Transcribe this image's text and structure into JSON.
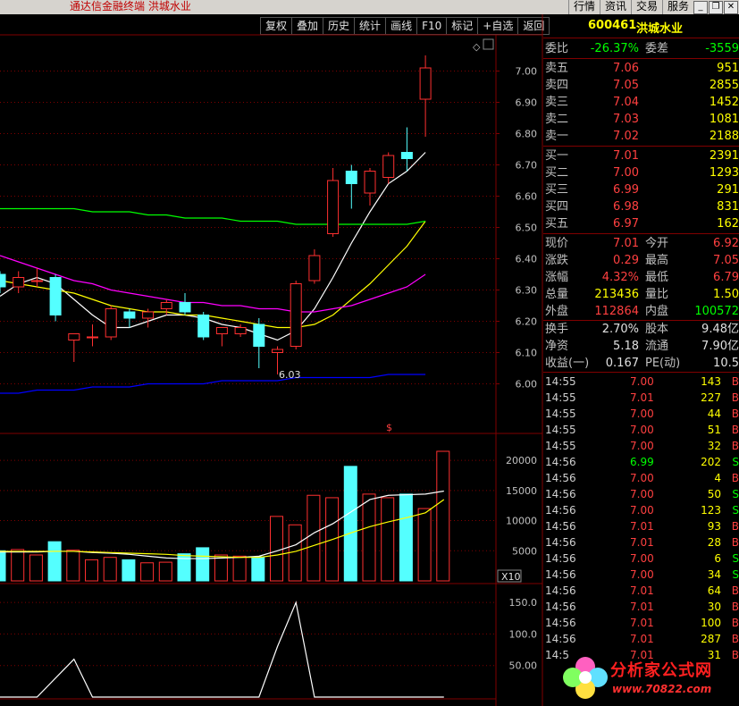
{
  "window": {
    "title": "通达信金融终端  洪城水业",
    "menu": [
      "行情",
      "资讯",
      "交易",
      "服务"
    ],
    "buttons": [
      "_",
      "❐",
      "✕"
    ]
  },
  "toolbar": [
    "复权",
    "叠加",
    "历史",
    "统计",
    "画线",
    "F10",
    "标记",
    "+自选",
    "返回"
  ],
  "chart_data": [
    {
      "type": "candlestick",
      "panel": "price",
      "y_ticks": [
        "7.00",
        "6.90",
        "6.80",
        "6.70",
        "6.60",
        "6.50",
        "6.40",
        "6.30",
        "6.20",
        "6.10",
        "6.00"
      ],
      "ylim": [
        5.97,
        7.05
      ],
      "candles": [
        {
          "o": 6.35,
          "c": 6.31,
          "h": 6.36,
          "l": 6.29
        },
        {
          "o": 6.31,
          "c": 6.34,
          "h": 6.36,
          "l": 6.29
        },
        {
          "o": 6.33,
          "c": 6.33,
          "h": 6.37,
          "l": 6.31
        },
        {
          "o": 6.34,
          "c": 6.22,
          "h": 6.35,
          "l": 6.2
        },
        {
          "o": 6.14,
          "c": 6.16,
          "h": 6.16,
          "l": 6.07
        },
        {
          "o": 6.15,
          "c": 6.15,
          "h": 6.19,
          "l": 6.12
        },
        {
          "o": 6.15,
          "c": 6.24,
          "h": 6.25,
          "l": 6.14
        },
        {
          "o": 6.23,
          "c": 6.21,
          "h": 6.24,
          "l": 6.18
        },
        {
          "o": 6.21,
          "c": 6.23,
          "h": 6.24,
          "l": 6.18
        },
        {
          "o": 6.24,
          "c": 6.26,
          "h": 6.27,
          "l": 6.22
        },
        {
          "o": 6.26,
          "c": 6.23,
          "h": 6.29,
          "l": 6.22
        },
        {
          "o": 6.22,
          "c": 6.15,
          "h": 6.23,
          "l": 6.14
        },
        {
          "o": 6.16,
          "c": 6.18,
          "h": 6.18,
          "l": 6.12
        },
        {
          "o": 6.16,
          "c": 6.18,
          "h": 6.19,
          "l": 6.15
        },
        {
          "o": 6.19,
          "c": 6.12,
          "h": 6.21,
          "l": 6.05
        },
        {
          "o": 6.1,
          "c": 6.11,
          "h": 6.12,
          "l": 6.03
        },
        {
          "o": 6.12,
          "c": 6.32,
          "h": 6.33,
          "l": 6.11
        },
        {
          "o": 6.33,
          "c": 6.41,
          "h": 6.43,
          "l": 6.32
        },
        {
          "o": 6.48,
          "c": 6.65,
          "h": 6.69,
          "l": 6.47
        },
        {
          "o": 6.68,
          "c": 6.64,
          "h": 6.7,
          "l": 6.56
        },
        {
          "o": 6.61,
          "c": 6.68,
          "h": 6.69,
          "l": 6.57
        },
        {
          "o": 6.66,
          "c": 6.73,
          "h": 6.74,
          "l": 6.64
        },
        {
          "o": 6.74,
          "c": 6.72,
          "h": 6.82,
          "l": 6.68
        },
        {
          "o": 6.91,
          "c": 7.01,
          "h": 7.05,
          "l": 6.79
        }
      ],
      "ma": [
        {
          "color": "#ffffff",
          "values": [
            6.28,
            6.32,
            6.34,
            6.32,
            6.27,
            6.22,
            6.18,
            6.18,
            6.2,
            6.22,
            6.22,
            6.21,
            6.19,
            6.18,
            6.16,
            6.14,
            6.17,
            6.24,
            6.34,
            6.45,
            6.55,
            6.64,
            6.68,
            6.74
          ]
        },
        {
          "color": "#ffff00",
          "values": [
            6.33,
            6.32,
            6.31,
            6.3,
            6.29,
            6.27,
            6.25,
            6.24,
            6.23,
            6.23,
            6.22,
            6.22,
            6.21,
            6.2,
            6.19,
            6.18,
            6.18,
            6.19,
            6.22,
            6.27,
            6.32,
            6.38,
            6.44,
            6.52
          ]
        },
        {
          "color": "#ff00ff",
          "values": [
            6.41,
            6.39,
            6.37,
            6.35,
            6.33,
            6.32,
            6.3,
            6.29,
            6.28,
            6.27,
            6.26,
            6.26,
            6.25,
            6.25,
            6.24,
            6.24,
            6.23,
            6.23,
            6.24,
            6.25,
            6.27,
            6.29,
            6.31,
            6.35
          ]
        },
        {
          "color": "#00ff00",
          "values": [
            6.56,
            6.56,
            6.56,
            6.56,
            6.56,
            6.55,
            6.55,
            6.55,
            6.54,
            6.54,
            6.53,
            6.53,
            6.53,
            6.52,
            6.52,
            6.52,
            6.51,
            6.51,
            6.51,
            6.51,
            6.51,
            6.51,
            6.51,
            6.52
          ]
        },
        {
          "color": "#0000ff",
          "values": [
            5.97,
            5.97,
            5.98,
            5.98,
            5.98,
            5.99,
            5.99,
            5.99,
            6.0,
            6.0,
            6.0,
            6.0,
            6.01,
            6.01,
            6.01,
            6.01,
            6.02,
            6.02,
            6.02,
            6.02,
            6.02,
            6.03,
            6.03,
            6.03
          ]
        }
      ],
      "low_label": "6.03",
      "marker": "$"
    },
    {
      "type": "bar",
      "panel": "volume",
      "unit_label": "X10",
      "y_ticks": [
        "20000",
        "15000",
        "10000",
        "5000"
      ],
      "ylim": [
        0,
        21500
      ],
      "values": [
        5000,
        5200,
        4300,
        6500,
        5100,
        3500,
        3900,
        3500,
        3000,
        3100,
        4500,
        5500,
        4300,
        4100,
        4000,
        10700,
        9300,
        14200,
        13800,
        19000,
        14400,
        13800,
        14400,
        12000,
        21500
      ],
      "ma": [
        {
          "color": "#ffffff",
          "values": [
            4800,
            4800,
            4800,
            4900,
            4900,
            4700,
            4600,
            4400,
            4100,
            3800,
            3700,
            3700,
            3800,
            3900,
            4100,
            5000,
            6000,
            8000,
            9500,
            11500,
            13500,
            14200,
            14300,
            14400,
            14900
          ]
        },
        {
          "color": "#ffff00",
          "values": [
            4900,
            4900,
            4900,
            4900,
            4900,
            4800,
            4700,
            4600,
            4500,
            4400,
            4200,
            4100,
            4000,
            3900,
            3900,
            4300,
            4900,
            5900,
            6900,
            8000,
            9000,
            9800,
            10500,
            11300,
            13500
          ]
        }
      ]
    },
    {
      "type": "line",
      "panel": "indicator",
      "y_ticks": [
        "150.0",
        "100.0",
        "50.00"
      ],
      "ylim": [
        0,
        170
      ],
      "values": [
        0,
        0,
        0,
        30,
        60,
        0,
        0,
        0,
        0,
        0,
        0,
        0,
        0,
        0,
        0,
        80,
        150,
        0,
        0,
        0,
        0,
        0,
        0,
        0,
        0
      ]
    }
  ],
  "panel": {
    "code": "600461",
    "name": "洪城水业",
    "webi": {
      "label": "委比",
      "value": "-26.37%",
      "label2": "委差",
      "value2": "-3559"
    },
    "asks": [
      {
        "label": "卖五",
        "price": "7.06",
        "vol": "951"
      },
      {
        "label": "卖四",
        "price": "7.05",
        "vol": "2855"
      },
      {
        "label": "卖三",
        "price": "7.04",
        "vol": "1452"
      },
      {
        "label": "卖二",
        "price": "7.03",
        "vol": "1081"
      },
      {
        "label": "卖一",
        "price": "7.02",
        "vol": "2188"
      }
    ],
    "bids": [
      {
        "label": "买一",
        "price": "7.01",
        "vol": "2391"
      },
      {
        "label": "买二",
        "price": "7.00",
        "vol": "1293"
      },
      {
        "label": "买三",
        "price": "6.99",
        "vol": "291"
      },
      {
        "label": "买四",
        "price": "6.98",
        "vol": "831"
      },
      {
        "label": "买五",
        "price": "6.97",
        "vol": "162"
      }
    ],
    "quote": [
      {
        "l1": "现价",
        "v1": "7.01",
        "c1": "#ff4040",
        "l2": "今开",
        "v2": "6.92",
        "c2": "#ff4040"
      },
      {
        "l1": "涨跌",
        "v1": "0.29",
        "c1": "#ff4040",
        "l2": "最高",
        "v2": "7.05",
        "c2": "#ff4040"
      },
      {
        "l1": "涨幅",
        "v1": "4.32%",
        "c1": "#ff4040",
        "l2": "最低",
        "v2": "6.79",
        "c2": "#ff4040"
      },
      {
        "l1": "总量",
        "v1": "213436",
        "c1": "#ffff00",
        "l2": "量比",
        "v2": "1.50",
        "c2": "#ffff00"
      },
      {
        "l1": "外盘",
        "v1": "112864",
        "c1": "#ff4040",
        "l2": "内盘",
        "v2": "100572",
        "c2": "#00ff00"
      }
    ],
    "fin": [
      {
        "l1": "换手",
        "v1": "2.70%",
        "l2": "股本",
        "v2": "9.48亿"
      },
      {
        "l1": "净资",
        "v1": "5.18",
        "l2": "流通",
        "v2": "7.90亿"
      },
      {
        "l1": "收益(一)",
        "v1": "0.167",
        "l2": "PE(动)",
        "v2": "10.5"
      }
    ],
    "ticks": [
      {
        "time": "14:55",
        "price": "7.00",
        "vol": "143",
        "bs": "B"
      },
      {
        "time": "14:55",
        "price": "7.01",
        "vol": "227",
        "bs": "B"
      },
      {
        "time": "14:55",
        "price": "7.00",
        "vol": "44",
        "bs": "B"
      },
      {
        "time": "14:55",
        "price": "7.00",
        "vol": "51",
        "bs": "B"
      },
      {
        "time": "14:55",
        "price": "7.00",
        "vol": "32",
        "bs": "B"
      },
      {
        "time": "14:56",
        "price": "6.99",
        "vol": "202",
        "bs": "S"
      },
      {
        "time": "14:56",
        "price": "7.00",
        "vol": "4",
        "bs": "B"
      },
      {
        "time": "14:56",
        "price": "7.00",
        "vol": "50",
        "bs": "S"
      },
      {
        "time": "14:56",
        "price": "7.00",
        "vol": "123",
        "bs": "S"
      },
      {
        "time": "14:56",
        "price": "7.01",
        "vol": "93",
        "bs": "B"
      },
      {
        "time": "14:56",
        "price": "7.01",
        "vol": "28",
        "bs": "B"
      },
      {
        "time": "14:56",
        "price": "7.00",
        "vol": "6",
        "bs": "S"
      },
      {
        "time": "14:56",
        "price": "7.00",
        "vol": "34",
        "bs": "S"
      },
      {
        "time": "14:56",
        "price": "7.01",
        "vol": "64",
        "bs": "B"
      },
      {
        "time": "14:56",
        "price": "7.01",
        "vol": "30",
        "bs": "B"
      },
      {
        "time": "14:56",
        "price": "7.01",
        "vol": "100",
        "bs": "B"
      },
      {
        "time": "14:56",
        "price": "7.01",
        "vol": "287",
        "bs": "B"
      },
      {
        "time": "14:5",
        "price": "7.01",
        "vol": "31",
        "bs": "B"
      }
    ]
  },
  "watermark": {
    "text": "分析家公式网",
    "url": "www.70822.com"
  },
  "colors": {
    "up": "#ff3030",
    "down": "#54ffff",
    "grid": "#800000",
    "axis_text": "#c0c0c0"
  }
}
